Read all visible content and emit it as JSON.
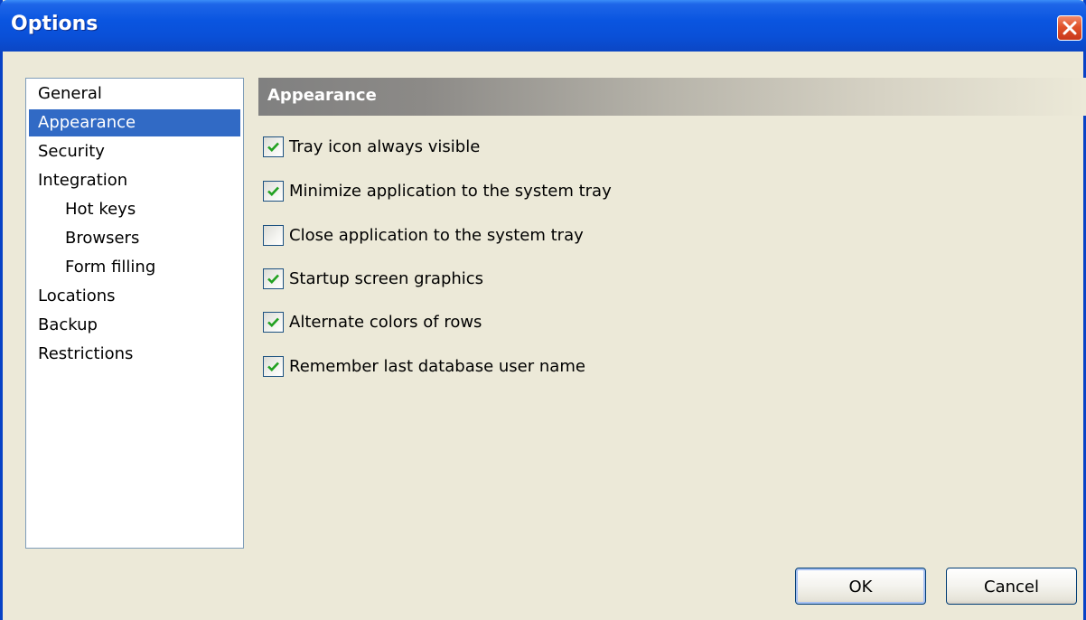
{
  "window": {
    "title": "Options",
    "close_icon": "close-icon"
  },
  "nav": {
    "items": [
      {
        "label": "General",
        "indent": 0,
        "selected": false
      },
      {
        "label": "Appearance",
        "indent": 0,
        "selected": true
      },
      {
        "label": "Security",
        "indent": 0,
        "selected": false
      },
      {
        "label": "Integration",
        "indent": 0,
        "selected": false
      },
      {
        "label": "Hot keys",
        "indent": 1,
        "selected": false
      },
      {
        "label": "Browsers",
        "indent": 1,
        "selected": false
      },
      {
        "label": "Form filling",
        "indent": 1,
        "selected": false
      },
      {
        "label": "Locations",
        "indent": 0,
        "selected": false
      },
      {
        "label": "Backup",
        "indent": 0,
        "selected": false
      },
      {
        "label": "Restrictions",
        "indent": 0,
        "selected": false
      }
    ]
  },
  "section": {
    "title": "Appearance"
  },
  "options": [
    {
      "label": "Tray icon always visible",
      "checked": true
    },
    {
      "label": "Minimize application to the system tray",
      "checked": true
    },
    {
      "label": "Close application to the system tray",
      "checked": false
    },
    {
      "label": "Startup screen graphics",
      "checked": true
    },
    {
      "label": "Alternate colors of rows",
      "checked": true
    },
    {
      "label": "Remember last database user name",
      "checked": true
    }
  ],
  "buttons": {
    "ok_label": "OK",
    "cancel_label": "Cancel"
  },
  "colors": {
    "titlebar": "#0a55e0",
    "selection": "#316ac5",
    "checkmark": "#21a121",
    "close_button": "#e0522a"
  }
}
